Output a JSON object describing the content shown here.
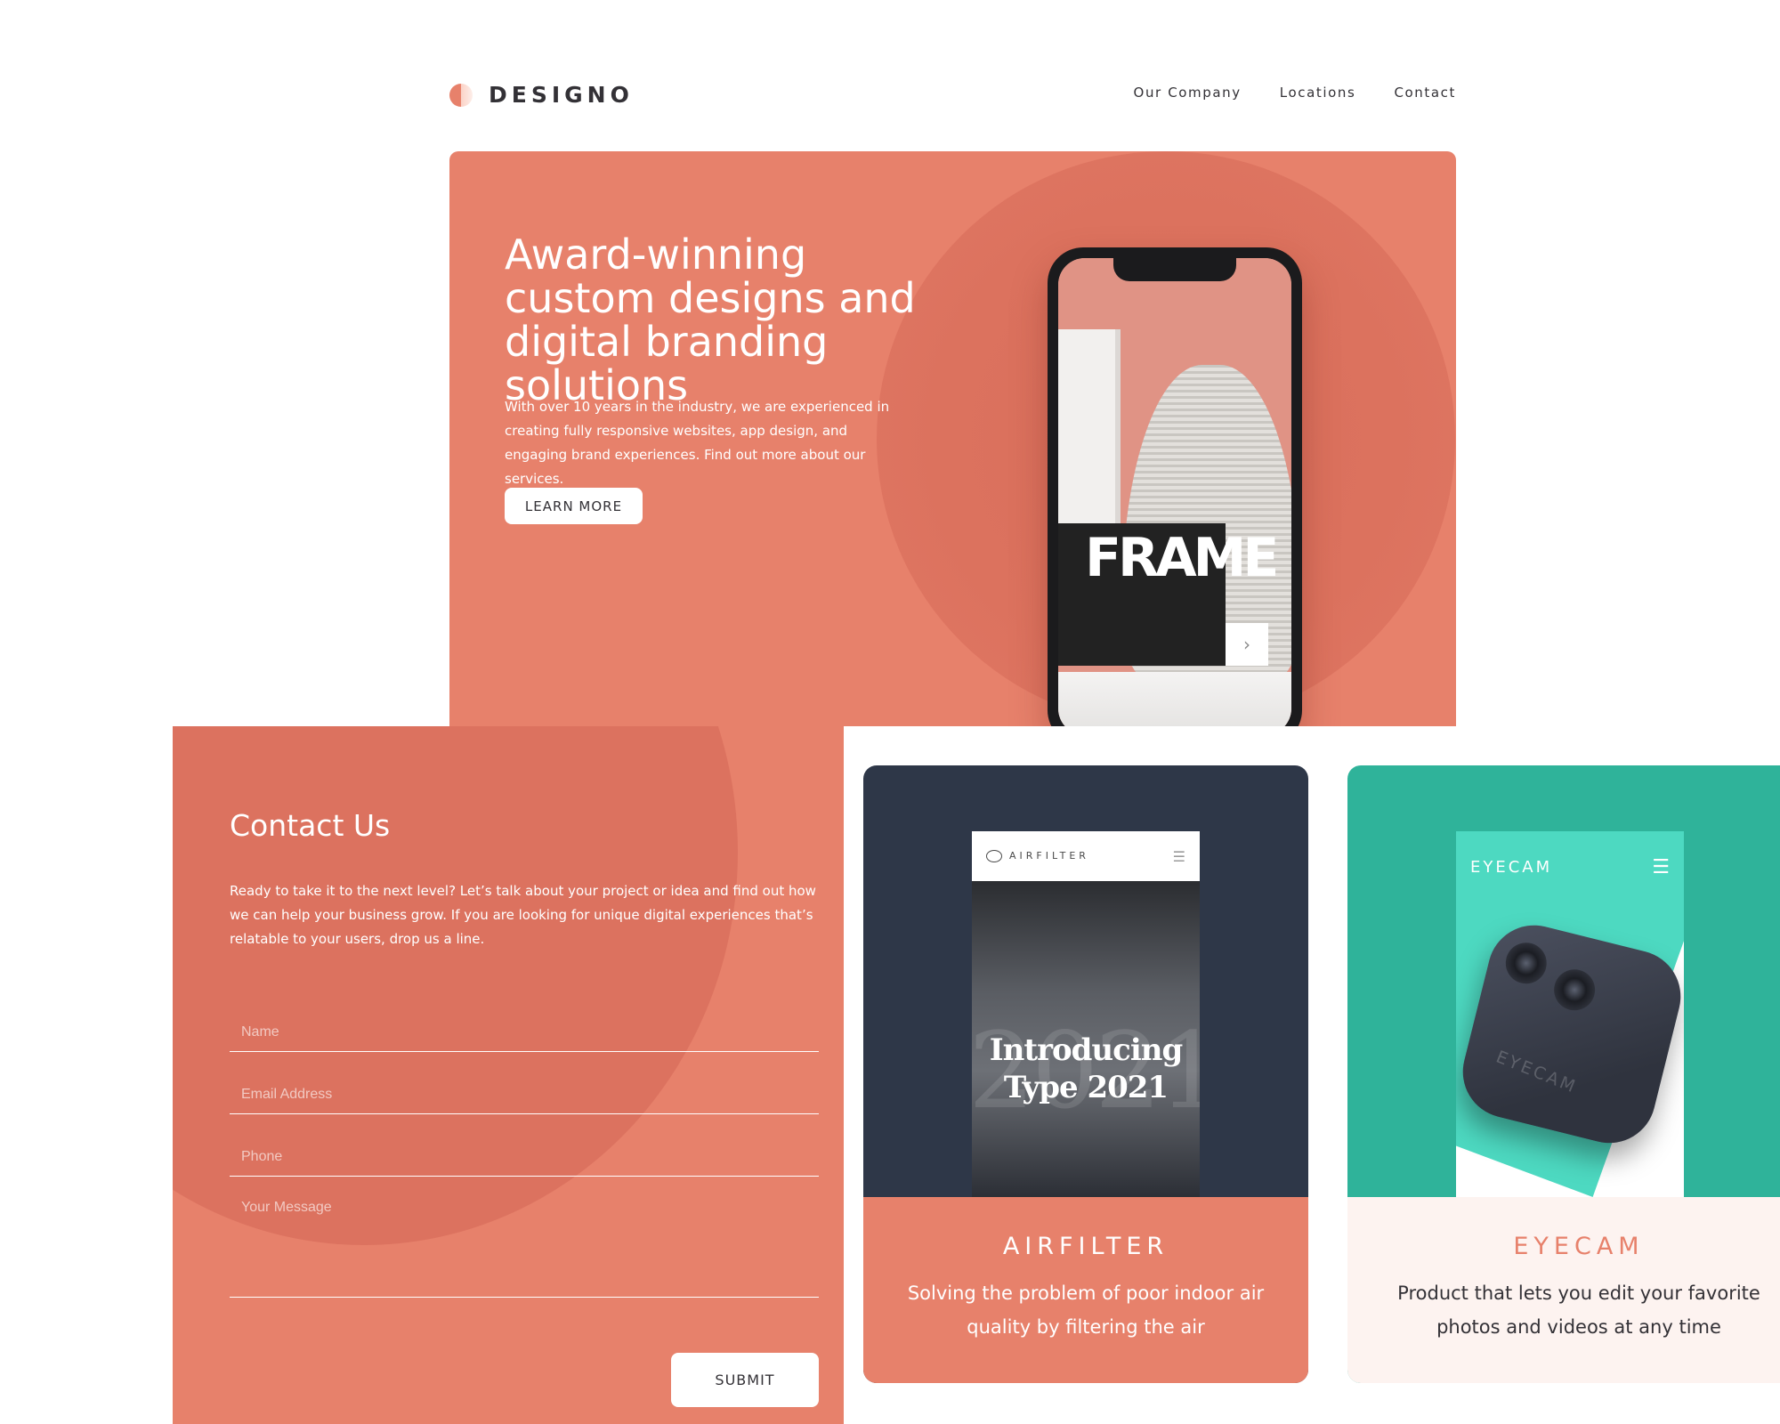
{
  "brand": {
    "name": "DESIGNO",
    "logo_icon": "logo-half-circle-icon"
  },
  "nav": {
    "items": [
      "Our Company",
      "Locations",
      "Contact"
    ]
  },
  "hero": {
    "title": "Award-winning custom designs and digital branding solutions",
    "body": "With over 10 years in the industry, we are experienced in creating fully responsive websites, app design, and engaging brand experiences. Find out more about our services.",
    "button": "LEARN MORE",
    "phone_screen_text": "FRAME",
    "phone_next_icon": "chevron-right-icon"
  },
  "contact": {
    "title": "Contact Us",
    "body": "Ready to take it to the next level? Let’s talk about your project or idea and find out how we can help your business grow. If you are looking for unique digital experiences that’s relatable to your users, drop us a line.",
    "fields": {
      "name_placeholder": "Name",
      "email_placeholder": "Email Address",
      "phone_placeholder": "Phone",
      "message_placeholder": "Your Message"
    },
    "submit": "SUBMIT"
  },
  "cards": [
    {
      "title": "AIRFILTER",
      "description": "Solving the problem of poor indoor air quality by filtering the air",
      "screen_logo": "AIRFILTER",
      "screen_headline": "Introducing Type 2021",
      "screen_background_text": "2021"
    },
    {
      "title": "EYECAM",
      "description": "Product that lets you edit your favorite photos and videos at any time",
      "screen_logo": "EYECAM",
      "device_label": "EYECAM"
    }
  ],
  "colors": {
    "peach": "#e7816b",
    "dark_text": "#333136",
    "airfilter_bg": "#2e3748",
    "eyecam_bg": "#2fb39a",
    "eyecam_footer": "#fdf3f0"
  }
}
